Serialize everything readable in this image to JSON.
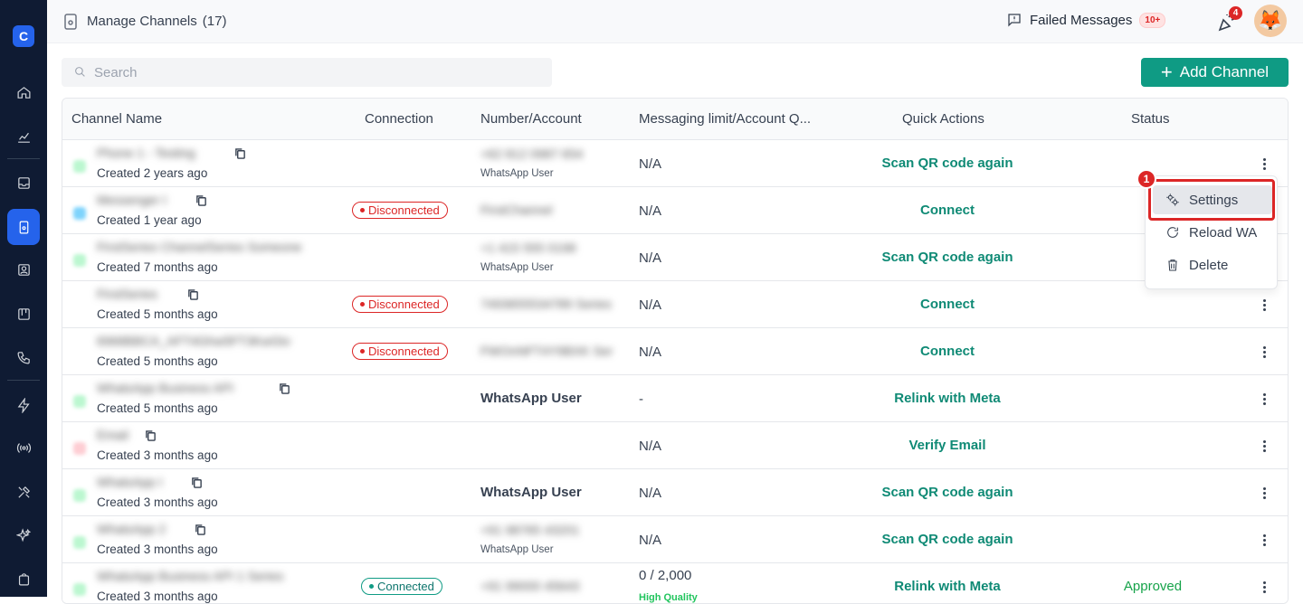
{
  "sidebar": {
    "logo": "C",
    "items": [
      "home",
      "analytics",
      "inbox",
      "channels",
      "contacts",
      "board",
      "calls",
      "automation",
      "broadcast",
      "tools",
      "ai",
      "store"
    ]
  },
  "header": {
    "title": "Manage Channels",
    "count": "(17)",
    "failed_label": "Failed Messages",
    "failed_badge": "10+",
    "notif_count": "4",
    "avatar": "🦊"
  },
  "search": {
    "placeholder": "Search"
  },
  "add_button": {
    "label": "Add Channel",
    "icon": "+"
  },
  "table": {
    "columns": [
      "Channel Name",
      "Connection",
      "Number/Account",
      "Messaging limit/Account Q...",
      "Quick Actions",
      "Status"
    ],
    "rows": [
      {
        "name": "Phone 1 - Testing",
        "created": "Created 2 years ago",
        "dot_color": "#bbf7d0",
        "connection": "",
        "number": "+62 812 0987 654",
        "number_sub": "WhatsApp User",
        "number_bold": "",
        "msg": "N/A",
        "action": "Scan QR code again",
        "status": ""
      },
      {
        "name": "Messenger I",
        "created": "Created 1 year ago",
        "dot_color": "#7dd3fc",
        "connection": "Disconnected",
        "number": "FirstChannel",
        "number_sub": "",
        "number_bold": "",
        "msg": "N/A",
        "action": "Connect",
        "status": ""
      },
      {
        "name": "FirstSeries ChannelSeries Someone",
        "created": "Created 7 months ago",
        "dot_color": "#bbf7d0",
        "connection": "",
        "number": "+1 415 555 0198",
        "number_sub": "WhatsApp User",
        "number_bold": "",
        "msg": "N/A",
        "action": "Scan QR code again",
        "status": ""
      },
      {
        "name": "FirstSeries",
        "created": "Created 5 months ago",
        "dot_color": "",
        "connection": "Disconnected",
        "number": "7493655534789 Series",
        "number_sub": "",
        "number_bold": "",
        "msg": "N/A",
        "action": "Connect",
        "status": ""
      },
      {
        "name": "6968BBCA_AFT4Ghw5FT3KwGtv",
        "created": "Created 5 months ago",
        "dot_color": "",
        "connection": "Disconnected",
        "number": "FWOnNFT4Y9BXK Ser",
        "number_sub": "",
        "number_bold": "",
        "msg": "N/A",
        "action": "Connect",
        "status": ""
      },
      {
        "name": "WhatsApp Business API",
        "created": "Created 5 months ago",
        "dot_color": "#bbf7d0",
        "connection": "",
        "number": "",
        "number_sub": "",
        "number_bold": "WhatsApp User",
        "msg": "-",
        "action": "Relink with Meta",
        "status": ""
      },
      {
        "name": "Email",
        "created": "Created 3 months ago",
        "dot_color": "#fecdd3",
        "connection": "",
        "number": "",
        "number_sub": "",
        "number_bold": "",
        "msg": "N/A",
        "action": "Verify Email",
        "status": ""
      },
      {
        "name": "WhatsApp I",
        "created": "Created 3 months ago",
        "dot_color": "#bbf7d0",
        "connection": "",
        "number": "",
        "number_sub": "",
        "number_bold": "WhatsApp User",
        "msg": "N/A",
        "action": "Scan QR code again",
        "status": ""
      },
      {
        "name": "WhatsApp 2",
        "created": "Created 3 months ago",
        "dot_color": "#bbf7d0",
        "connection": "",
        "number": "+91 98765 43201",
        "number_sub": "WhatsApp User",
        "number_bold": "",
        "msg": "N/A",
        "action": "Scan QR code again",
        "status": ""
      },
      {
        "name": "WhatsApp Business API 1 Series",
        "created": "Created 3 months ago",
        "dot_color": "#bbf7d0",
        "connection": "Connected",
        "number": "+91 99000 45643",
        "number_sub": "",
        "number_bold": "",
        "msg": "0 / 2,000",
        "msg_sub": "High Quality",
        "action": "Relink with Meta",
        "status": "Approved"
      }
    ]
  },
  "menu": {
    "step": "1",
    "items": [
      {
        "label": "Settings",
        "icon": "settings-icon"
      },
      {
        "label": "Reload WA",
        "icon": "reload-icon"
      },
      {
        "label": "Delete",
        "icon": "trash-icon"
      }
    ]
  }
}
